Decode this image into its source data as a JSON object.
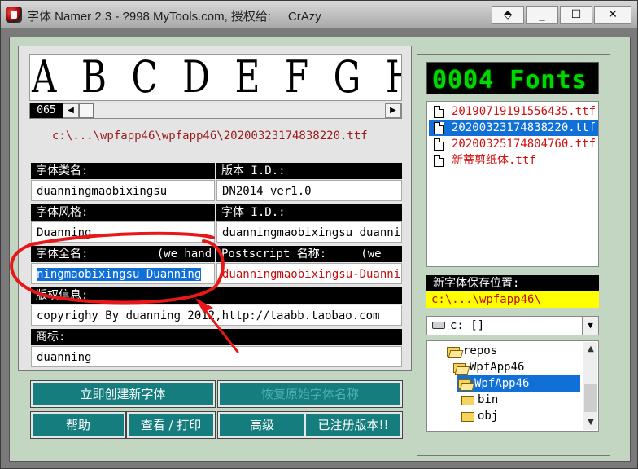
{
  "window": {
    "title": "字体 Namer 2.3 - ?998 MyTools.com, 授权给:     CrAzy",
    "shade_glyph": "⬘",
    "minimize_glyph": "_",
    "maximize_glyph": "☐",
    "close_glyph": "✕"
  },
  "preview": {
    "sample_text": "A B C D E F G H I J",
    "glyph_code": "065",
    "scroll_left": "◀",
    "scroll_right": "▶",
    "file_path": "c:\\...\\wpfapp46\\wpfapp46\\20200323174838220.ttf"
  },
  "fields": {
    "family_label": "字体类名:",
    "family_value": "duanningmaobixingsu",
    "version_label": "版本 I.D.:",
    "version_value": "DN2014 ver1.0",
    "style_label": "字体风格:",
    "style_value": "Duanning",
    "id_label": "字体 I.D.:",
    "id_value": "duanningmaobixingsu duanni",
    "fullname_label": "字体全名:          (we hand",
    "fullname_value": "ningmaobixingsu Duanning",
    "postscript_label": "Postscript 名称:     (we",
    "postscript_value": "duanningmaobixingsu-Duanni",
    "copyright_label": "版权信息:",
    "copyright_value": "copyrighy By duanning 2012,http://taabb.taobao.com",
    "trademark_label": "商标:",
    "trademark_value": "duanning"
  },
  "buttons": {
    "create": "立即创建新字体",
    "restore": "恢复原始字体名称",
    "help": "帮助",
    "view_print": "查看 / 打印",
    "advanced": "高级",
    "registered": "已注册版本!!"
  },
  "font_panel": {
    "count_display": "0004 Fonts",
    "fonts": [
      "20190719191556435.ttf",
      "20200323174838220.ttf",
      "20200325174804760.ttf",
      "新蒂剪纸体.ttf"
    ],
    "save_label": "新字体保存位置:",
    "save_path": "c:\\...\\wpfapp46\\",
    "drive": "c:  []",
    "drive_arrow": "▼",
    "dirs": [
      "repos",
      "WpfApp46",
      "WpfApp46",
      "bin",
      "obj"
    ],
    "tree_up": "▲",
    "tree_down": "▼"
  },
  "colors": {
    "accent_button": "#157d7d",
    "selection": "#1070d8",
    "annotation": "#e81818",
    "led": "#00ff00"
  }
}
